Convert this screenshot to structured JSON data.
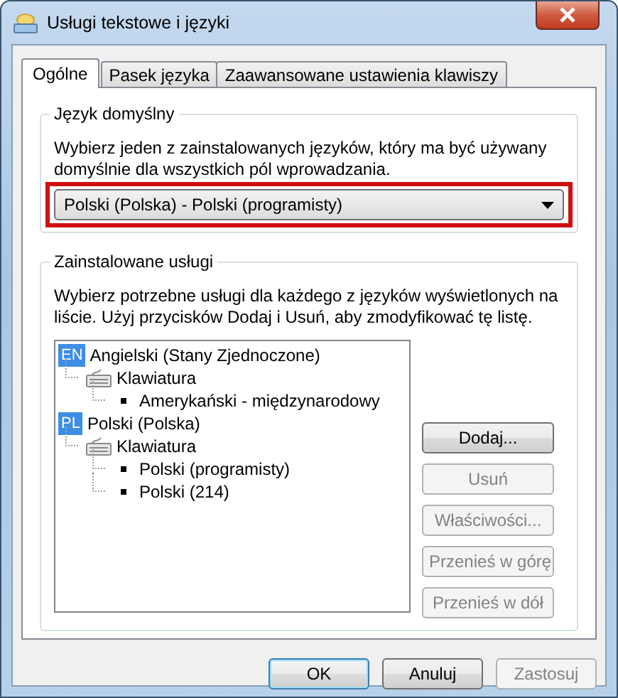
{
  "window": {
    "title": "Usługi tekstowe i języki"
  },
  "tabs": [
    {
      "label": "Ogólne",
      "selected": true
    },
    {
      "label": "Pasek języka",
      "selected": false
    },
    {
      "label": "Zaawansowane ustawienia klawiszy",
      "selected": false
    }
  ],
  "default_language": {
    "heading": "Język domyślny",
    "description": "Wybierz jeden z zainstalowanych języków, który ma być używany domyślnie dla wszystkich pól wprowadzania.",
    "dropdown": {
      "value": "Polski (Polska) - Polski (programisty)",
      "highlighted": true
    }
  },
  "installed_services": {
    "heading": "Zainstalowane usługi",
    "description": "Wybierz potrzebne usługi dla każdego z języków wyświetlonych na liście. Użyj przycisków Dodaj i Usuń, aby zmodyfikować tę listę.",
    "tree": [
      {
        "kind": "language",
        "badge": "EN",
        "label": "Angielski (Stany Zjednoczone)",
        "children": [
          {
            "kind": "category",
            "label": "Klawiatura",
            "children": [
              {
                "kind": "service",
                "label": "Amerykański - międzynarodowy"
              }
            ]
          }
        ]
      },
      {
        "kind": "language",
        "badge": "PL",
        "label": "Polski (Polska)",
        "children": [
          {
            "kind": "category",
            "label": "Klawiatura",
            "children": [
              {
                "kind": "service",
                "label": "Polski (programisty)"
              },
              {
                "kind": "service",
                "label": "Polski (214)"
              }
            ]
          }
        ]
      }
    ],
    "buttons": [
      {
        "label": "Dodaj...",
        "disabled": false
      },
      {
        "label": "Usuń",
        "disabled": true
      },
      {
        "label": "Właściwości...",
        "disabled": true
      },
      {
        "label": "Przenieś w górę",
        "disabled": true
      },
      {
        "label": "Przenieś w dół",
        "disabled": true
      }
    ]
  },
  "dialog_buttons": [
    {
      "label": "OK",
      "disabled": false,
      "default": true
    },
    {
      "label": "Anuluj",
      "disabled": false,
      "default": false
    },
    {
      "label": "Zastosuj",
      "disabled": true,
      "default": false
    }
  ]
}
